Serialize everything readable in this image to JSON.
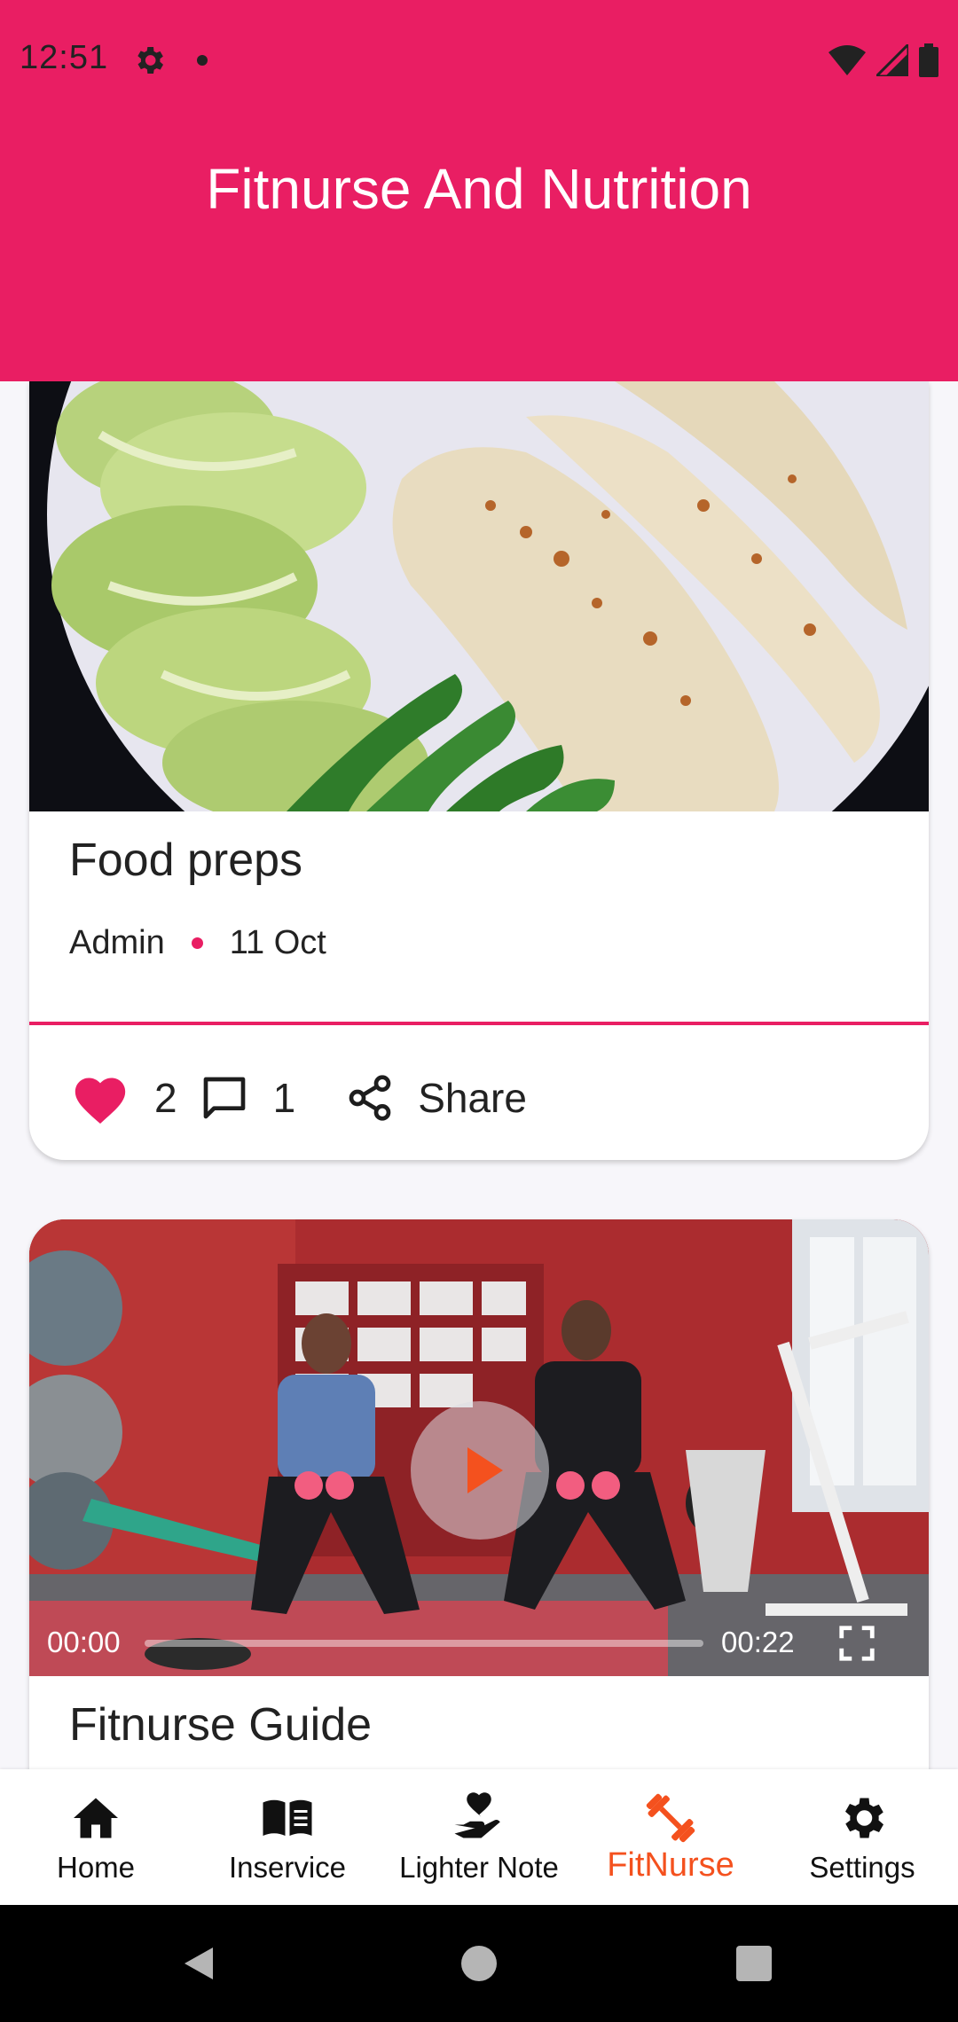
{
  "status_bar": {
    "time": "12:51",
    "icons": [
      "settings-icon",
      "notification-dot",
      "wifi-icon",
      "signal-icon",
      "battery-icon"
    ]
  },
  "header": {
    "title": "Fitnurse And Nutrition",
    "background_color": "#e91e63"
  },
  "feed": {
    "posts": [
      {
        "title": "Food preps",
        "author": "Admin",
        "date": "11 Oct",
        "likes": "2",
        "comments": "1",
        "share_label": "Share",
        "media": "food-image"
      },
      {
        "title": "Fitnurse Guide",
        "media": "video",
        "video": {
          "current_time": "00:00",
          "duration": "00:22",
          "progress": 0.0
        }
      }
    ]
  },
  "bottom_nav": {
    "items": [
      {
        "label": "Home",
        "icon": "home-icon"
      },
      {
        "label": "Inservice",
        "icon": "book-icon"
      },
      {
        "label": "Lighter Note",
        "icon": "hand-heart-icon"
      },
      {
        "label": "FitNurse",
        "icon": "dumbbell-icon",
        "active": true
      },
      {
        "label": "Settings",
        "icon": "gear-icon"
      }
    ],
    "active_color": "#f4511e"
  },
  "accent_color": "#e91e63"
}
